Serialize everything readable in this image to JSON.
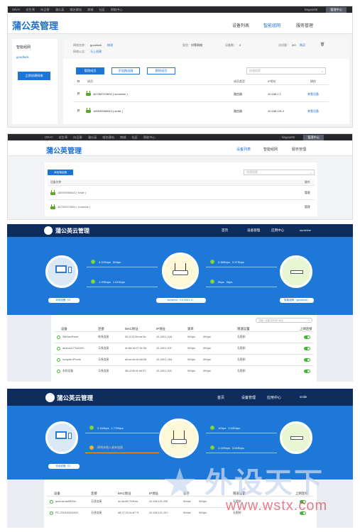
{
  "s1": {
    "nav": {
      "items": [
        "ORAY",
        "花生壳",
        "向日葵",
        "蒲公英",
        "域名建站",
        "商城",
        "社区",
        "帮助中心"
      ],
      "user": "kingaor00",
      "console": "管理中心"
    },
    "brand": "蒲公英管理",
    "menu": [
      "设备列表",
      "智能组网",
      "服务管理"
    ],
    "left": {
      "title": "智能组网",
      "network": "goodluck",
      "button": "立即创建网络"
    },
    "info": {
      "name_label": "网络名称：",
      "name_value": "goodluck",
      "edit": "修改",
      "notice_label": "网络公告：",
      "notice_value": "马上创建",
      "type_label": "类型：",
      "type_value": "对等网络",
      "count_label": "设备数：",
      "count_value": "2",
      "ip_label": "访问量：",
      "ip_value": "0/0",
      "buy": "购买"
    },
    "tabs": [
      "管理成员",
      "添加路由器",
      "删除成员"
    ],
    "search_placeholder": "快速搜索",
    "headers": [
      "成员",
      "成员类型",
      "IP地址",
      "操作"
    ],
    "rows": [
      {
        "name": "467352370694 ( sunshine )",
        "type": "路由器",
        "ip": "10.168.1.1",
        "op": "查看设备"
      },
      {
        "name": "165993966043 ( smile )",
        "type": "路由器",
        "ip": "10.168.101.2",
        "op": "查看设备"
      }
    ]
  },
  "s2": {
    "nav": {
      "items": [
        "ORAY",
        "花生壳",
        "向日葵",
        "蒲公英",
        "域名建站",
        "商城",
        "社区",
        "帮助中心"
      ],
      "user": "kingaor00",
      "console": "管理中心"
    },
    "brand": "蒲公英管理",
    "menu": [
      "设备列表",
      "智能组网",
      "服务管理"
    ],
    "add_button": "添加路由器",
    "search_placeholder": "快速搜索",
    "headers": [
      "设备名称",
      "操作"
    ],
    "rows": [
      {
        "name": "165993966043 ( smile )",
        "op": "管理"
      },
      {
        "name": "467352370694 ( sunshine )",
        "op": "管理"
      }
    ]
  },
  "s3": {
    "brand": "蒲公英云管理",
    "menu": [
      "首页",
      "设备管理",
      "应用中心"
    ],
    "user": "sunshine",
    "left_speeds": [
      {
        "up": "0.02Kbps",
        "down": "0Kbps"
      },
      {
        "up": "1.29Kbps",
        "down": "1.61Kbps"
      }
    ],
    "right_speeds": [
      {
        "up": "2.98Kbps",
        "down": "3.37Kbps"
      },
      {
        "up": "0bps",
        "down": "0bps"
      }
    ],
    "pills": [
      "本地设备（4）",
      "sunshine（10.168.1.1）",
      "智能组网（goodluck）"
    ],
    "search_placeholder": "请输入设备名称或IP地址",
    "headers": [
      "设备",
      "连接",
      "MAC地址",
      "IP地址",
      "速率",
      "限速设置",
      "上网连接"
    ],
    "rows": [
      {
        "name": "SkiHardKnee",
        "conn": "有线连接",
        "mac": "00:1f:32:54:ea:5e",
        "ip": "10.168.1.144",
        "up": "0Kbps",
        "down": "0Kbps",
        "limit": "无限制"
      },
      {
        "name": "android-f77a22e9...",
        "conn": "无线连接",
        "mac": "4c:8d:c6:07:9c:36",
        "ip": "10.168.1.237",
        "up": "0Kbps",
        "down": "0Kbps",
        "limit": "无限制"
      },
      {
        "name": "luckyde-iPhone",
        "conn": "无线连接",
        "mac": "a0:ac:cb:cb:68:98",
        "ip": "10.168.1.164",
        "up": "0Kbps",
        "down": "0Kbps",
        "limit": "无限制"
      },
      {
        "name": "未知设备",
        "conn": "无线连接",
        "mac": "38:c2:60:f1:e6:57",
        "ip": "10.168.1.241",
        "up": "0Kbps",
        "down": "0Kbps",
        "limit": "无限制"
      }
    ]
  },
  "s4": {
    "brand": "蒲公英云管理",
    "menu": [
      "首页",
      "设备管理",
      "应用中心"
    ],
    "user": "smile",
    "left_speed": {
      "up": "2.11Kbps",
      "down": "1.77Kbps"
    },
    "warning": "网线未插入或未连接",
    "right_speeds": [
      {
        "up": "1Kbps",
        "down": "2.04Kbps"
      },
      {
        "up": "1.02Kbps",
        "down": "3.58Kbps"
      }
    ],
    "pill": "本地设备（2）",
    "headers": [
      "设备",
      "连接",
      "MAC地址",
      "IP地址",
      "速率",
      "限速设置",
      "上网连接"
    ],
    "rows": [
      {
        "name": "android-ae6549e...",
        "conn": "无线连接",
        "mac": "4c:3a:86:7f:0f:ea",
        "ip": "10.168.101.205",
        "up": "0Kbps",
        "down": "0Kbps",
        "limit": "无限制"
      },
      {
        "name": "PC-201610261502",
        "conn": "无线连接",
        "mac": "68:17:29:4c:87:7f",
        "ip": "10.168.101.101",
        "up": "0Kbps",
        "down": "0Kbps",
        "limit": "无限制"
      }
    ],
    "watermark": "外设天下",
    "watermark_url": "www.wstx.com"
  }
}
